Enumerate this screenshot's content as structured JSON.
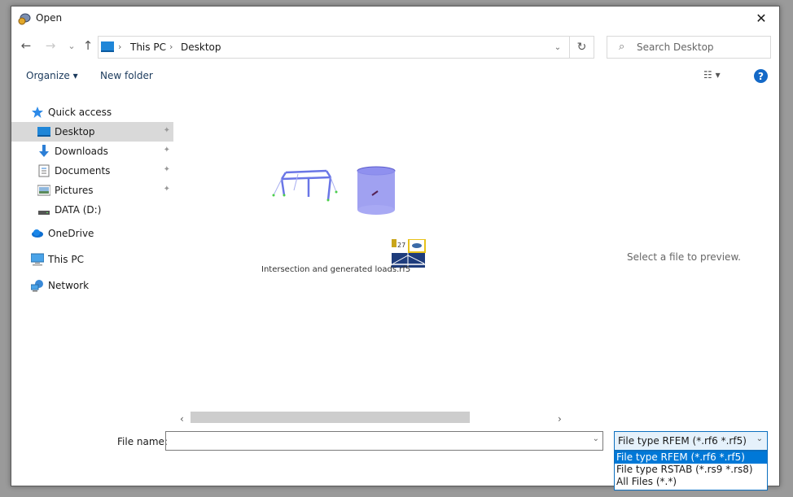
{
  "window": {
    "title": "Open",
    "close_label": "✕"
  },
  "nav": {
    "back_icon": "←",
    "forward_icon": "→",
    "recent_icon": "⌄",
    "up_icon": "↑",
    "breadcrumbs": [
      "This PC",
      "Desktop"
    ],
    "separator": "›",
    "address_dropdown_icon": "⌄",
    "refresh_icon": "↻",
    "search_placeholder": "Search Desktop",
    "search_icon": "⌕"
  },
  "toolbar": {
    "organize_label": "Organize ▾",
    "new_folder_label": "New folder",
    "view_icon": "☷ ▾",
    "help_label": "?"
  },
  "sidebar": {
    "items": [
      {
        "label": "Quick access",
        "icon": "star-icon"
      },
      {
        "label": "Desktop",
        "icon": "desktop-icon",
        "selected": true,
        "pinned": true
      },
      {
        "label": "Downloads",
        "icon": "download-icon",
        "pinned": true
      },
      {
        "label": "Documents",
        "icon": "document-icon",
        "pinned": true
      },
      {
        "label": "Pictures",
        "icon": "picture-icon",
        "pinned": true
      },
      {
        "label": "DATA (D:)",
        "icon": "drive-icon"
      },
      {
        "label": "OneDrive",
        "icon": "cloud-icon"
      },
      {
        "label": "This PC",
        "icon": "computer-icon"
      },
      {
        "label": "Network",
        "icon": "network-icon"
      }
    ],
    "pin_glyph": "📌"
  },
  "content": {
    "files": [
      {
        "name": "Intersection and generated loads.rf5",
        "badge": "5.27"
      }
    ],
    "scroll_left": "‹",
    "scroll_right": "›"
  },
  "preview": {
    "text": "Select a file to preview."
  },
  "footer": {
    "file_name_label": "File name:",
    "file_name_value": "",
    "file_name_dropdown": "⌄",
    "file_type_selected": "File type RFEM (*.rf6 *.rf5)",
    "file_type_dropdown": "⌄",
    "file_type_options": [
      "File type RFEM (*.rf6 *.rf5)",
      "File type RSTAB (*.rs9 *.rs8)",
      "All Files (*.*)"
    ]
  },
  "colors": {
    "accent": "#0078d7",
    "selected_sidebar": "#d9d9d9",
    "help_blue": "#1469c7"
  }
}
